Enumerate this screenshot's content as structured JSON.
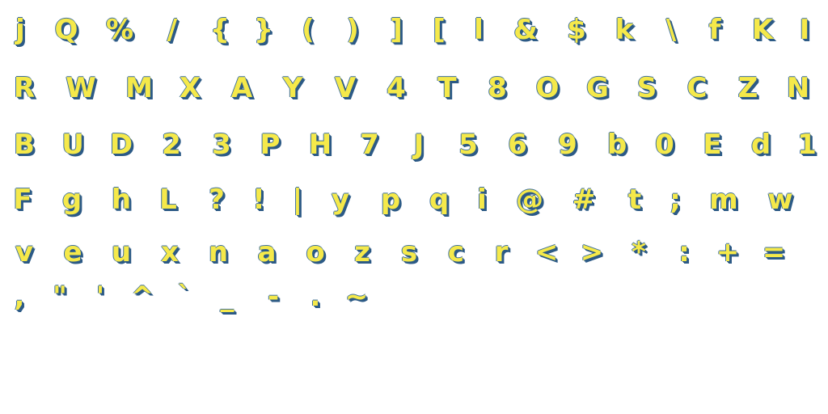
{
  "rows": [
    [
      "j",
      "Q",
      "%",
      "/",
      "{",
      "}",
      "(",
      ")",
      "]",
      "[",
      "l",
      "&",
      "$",
      "k",
      "\\",
      "f",
      "K",
      "I"
    ],
    [
      "R",
      "W",
      "M",
      "X",
      "A",
      "Y",
      "V",
      "4",
      "T",
      "8",
      "O",
      "G",
      "S",
      "C",
      "Z",
      "N"
    ],
    [
      "B",
      "U",
      "D",
      "2",
      "3",
      "P",
      "H",
      "7",
      "J",
      "5",
      "6",
      "9",
      "b",
      "0",
      "E",
      "d",
      "1"
    ],
    [
      "F",
      "g",
      "h",
      "L",
      "?",
      "!",
      "|",
      "y",
      "p",
      "q",
      "i",
      "@",
      "#",
      "t",
      ";",
      "m",
      "w"
    ],
    [
      "v",
      "e",
      "u",
      "x",
      "n",
      "a",
      "o",
      "z",
      "s",
      "c",
      "r",
      "<",
      ">",
      "*",
      ":",
      "+",
      "="
    ],
    [
      ",",
      "\"",
      "'",
      "^",
      "`",
      "_",
      "-",
      ".",
      "~"
    ]
  ],
  "colors": {
    "fill": "#f5e94a",
    "shadow": "#2c5a86",
    "background": "#ffffff"
  }
}
